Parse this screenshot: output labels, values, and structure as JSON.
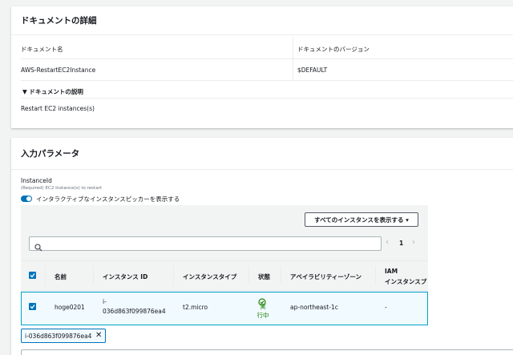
{
  "doc_details": {
    "title": "ドキュメントの詳細",
    "name_label": "ドキュメント名",
    "name_value": "AWS-RestartEC2Instance",
    "version_label": "ドキュメントのバージョン",
    "version_value": "$DEFAULT",
    "desc_label": "▼ ドキュメントの説明",
    "desc_value": "Restart EC2 instances(s)"
  },
  "params": {
    "title": "入力パラメータ",
    "field_label": "InstanceId",
    "field_hint": "(Required) EC2 Instance(s) to restart",
    "toggle_label": "インタラクティブなインスタンスピッカーを表示する",
    "show_all_button": "すべてのインスタンスを表示する ▾",
    "search_placeholder": "",
    "pager_prev": "‹",
    "pager_page": "1",
    "pager_next": "›"
  },
  "table": {
    "headers": {
      "name": "名前",
      "instance_id": "インスタンス ID",
      "instance_type": "インスタンスタイプ",
      "state": "状態",
      "az": "アベイラビリティーゾーン",
      "iam_line1": "IAM",
      "iam_line2": "インスタンスプ"
    },
    "rows": [
      {
        "name": "hoge0201",
        "instance_id_line1": "i-",
        "instance_id_line2": "036d863f099876ea4",
        "instance_type": "t2.micro",
        "state_line1": "実",
        "state_line2": "行中",
        "az": "ap-northeast-1c",
        "iam": "-"
      }
    ]
  },
  "selected_chip": {
    "value": "i-036d863f099876ea4",
    "remove": "✕"
  },
  "colors": {
    "accent": "#0073bb",
    "running": "#1d8102"
  }
}
